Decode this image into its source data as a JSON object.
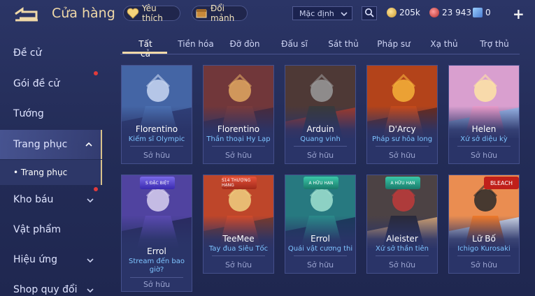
{
  "header": {
    "title": "Cửa hàng",
    "favorite_label": "Yêu thích",
    "exchange_label": "Đổi mảnh",
    "sort_value": "Mặc định",
    "gold": "205k",
    "rubies": "23 943",
    "tickets": "0",
    "plus": "+"
  },
  "sidebar": {
    "items": [
      {
        "label": "Đề cử"
      },
      {
        "label": "Gói đề cử"
      },
      {
        "label": "Tướng"
      },
      {
        "label": "Trang phục"
      },
      {
        "label": "Kho báu"
      },
      {
        "label": "Vật phẩm"
      },
      {
        "label": "Hiệu ứng"
      },
      {
        "label": "Shop quy đổi"
      }
    ],
    "sub_item": "• Trang phục"
  },
  "tabs": [
    "Tất cả",
    "Tiền hóa",
    "Đỡ đòn",
    "Đấu sĩ",
    "Sát thủ",
    "Pháp sư",
    "Xạ thủ",
    "Trợ thủ"
  ],
  "owned_label": "Sở hữu",
  "cards": [
    {
      "hero": "Florentino",
      "skin": "Kiếm sĩ Olympic",
      "badge": "",
      "colors": [
        "#4a6fb0",
        "#c9d7f2",
        "#2f3f78"
      ]
    },
    {
      "hero": "Florentino",
      "skin": "Thần thoại Hy Lạp",
      "badge": "",
      "colors": [
        "#7a3b3b",
        "#e0a861",
        "#4a2a3a"
      ]
    },
    {
      "hero": "Arduin",
      "skin": "Quang vinh",
      "badge": "",
      "colors": [
        "#3a3a3a",
        "#9a9a9a",
        "#a03a2a"
      ]
    },
    {
      "hero": "D'Arcy",
      "skin": "Pháp sư hỏa long",
      "badge": "",
      "colors": [
        "#c64a1a",
        "#f5b23a",
        "#6a2a1a"
      ]
    },
    {
      "hero": "Helen",
      "skin": "Xứ sở diệu kỳ",
      "badge": "",
      "colors": [
        "#e89ac8",
        "#fde4a4",
        "#9ab6e8"
      ]
    },
    {
      "hero": "Errol",
      "skin": "Stream đến bao giờ?",
      "badge": "S ĐẶC BIỆT",
      "colors": [
        "#5a4ab0",
        "#d8d0f0",
        "#2a2a60"
      ]
    },
    {
      "hero": "TeeMee",
      "skin": "Tay đua Siêu Tốc",
      "badge": "S14 THƯỢNG HẠNG",
      "colors": [
        "#d04a2a",
        "#f0d080",
        "#7a3a2a"
      ]
    },
    {
      "hero": "Errol",
      "skin": "Quái vật cương thi",
      "badge": "A HỮU HẠN",
      "colors": [
        "#2a8a8a",
        "#a0e0d0",
        "#1a3a5a"
      ]
    },
    {
      "hero": "Aleister",
      "skin": "Xứ sở thần tiên",
      "badge": "A HỮU HẠN",
      "colors": [
        "#2a2a3a",
        "#c03a3a",
        "#d0a070"
      ]
    },
    {
      "hero": "Lữ Bố",
      "skin": "Ichigo Kurosaki",
      "badge": "BLEACH",
      "colors": [
        "#f07a2a",
        "#2a2a2a",
        "#d0d8e8"
      ]
    }
  ],
  "icons": [
    "back-arrow-icon",
    "heart-icon",
    "chest-icon",
    "chevron-down-icon",
    "search-icon",
    "gold-coin-icon",
    "ruby-icon",
    "ticket-icon",
    "plus-icon",
    "chevron-up-icon"
  ],
  "colors": {
    "accent": "#f0d9a8",
    "skin_text": "#7ec4ff",
    "badge_red": "#e23b3b"
  }
}
